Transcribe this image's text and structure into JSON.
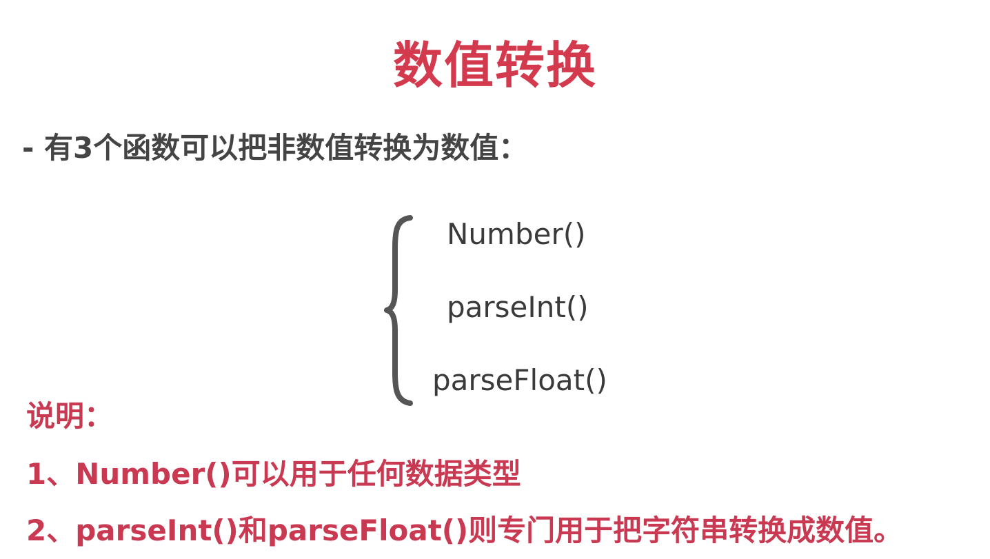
{
  "slide": {
    "title": "数值转换",
    "subtitle": "- 有3个函数可以把非数值转换为数值：",
    "functions": [
      "Number()",
      "parseInt()",
      "parseFloat()"
    ],
    "notes": {
      "heading": "说明：",
      "line1": "1、Number()可以用于任何数据类型",
      "line2": "2、parseInt()和parseFloat()则专门用于把字符串转换成数值。"
    }
  },
  "colors": {
    "accent": "#d33a4e",
    "text": "#444444"
  },
  "icons": {
    "brace": "left-curly-brace-icon"
  }
}
